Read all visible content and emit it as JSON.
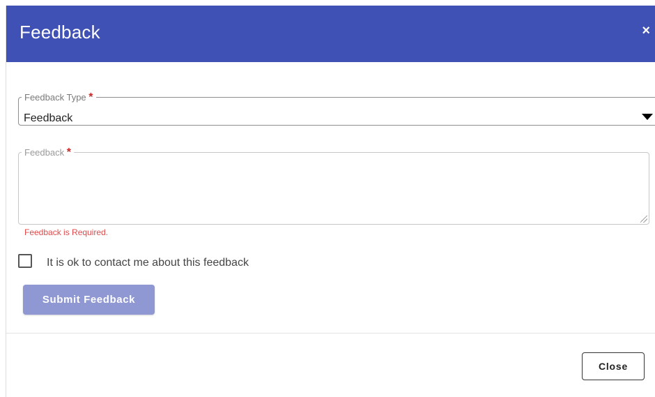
{
  "dialog": {
    "title": "Feedback",
    "close_symbol": "×"
  },
  "feedback_type": {
    "label": "Feedback Type",
    "required_mark": "*",
    "selected_value": "Feedback",
    "options_visible": [
      "Feedback"
    ]
  },
  "feedback_text": {
    "label": "Feedback",
    "required_mark": "*",
    "value": "",
    "error": "Feedback is Required."
  },
  "contact_consent": {
    "label": "It is ok to contact me about this feedback",
    "checked": false
  },
  "buttons": {
    "submit": "Submit Feedback",
    "close": "Close"
  },
  "colors": {
    "header": "#3f51b5",
    "submit_disabled": "#8f98d3",
    "error": "#e04a4a",
    "required": "#c62828"
  },
  "icons": {
    "dialog_close": "close-icon",
    "select_arrow": "caret-down-icon",
    "textarea_resize": "resize-grip-icon"
  }
}
